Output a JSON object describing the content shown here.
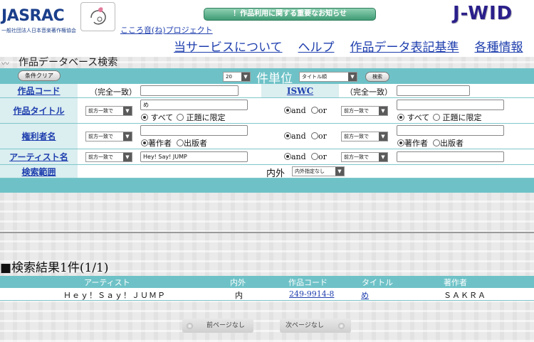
{
  "header": {
    "jasrac_logo": "JASRAC",
    "jasrac_sub": "一般社団法人日本音楽著作権協会",
    "kokoro_link": "こころ音(ね)プロジェクト",
    "notice": "！作品利用に関する重要なお知らせ",
    "jwid_logo": "J-WID",
    "nav": [
      "当サービスについて",
      "ヘルプ",
      "作品データ表記基準",
      "各種情報"
    ]
  },
  "page_title": "作品データベース検索",
  "search": {
    "clear_button": "条件クリア",
    "per_page": "20",
    "unit_label": "件単位",
    "order": "タイトル順",
    "search_button": "検索",
    "code_label": "作品コード",
    "code_hint": "（完全一致）",
    "iswc_label": "ISWC",
    "iswc_hint": "（完全一致）",
    "title_label": "作品タイトル",
    "title_match": "前方一致で",
    "title_value": "め",
    "title_opt_all": "すべて",
    "title_opt_main": "正題に限定",
    "and": "and",
    "or": "or",
    "title2_match": "前方一致で",
    "rights_label": "権利者名",
    "rights_match": "前方一致で",
    "rights_opt_author": "著作者",
    "rights_opt_publisher": "出版者",
    "rights2_match": "前方一致で",
    "artist_label": "アーティスト名",
    "artist_match": "前方一致で",
    "artist_value": "Hey! Say! JUMP",
    "artist2_match": "前方一致で",
    "scope_label": "検索範囲",
    "scope_text": "内外",
    "scope_select": "内外指定なし"
  },
  "results": {
    "title": "■検索結果1件(1/1)",
    "columns": [
      "アーティスト",
      "内外",
      "作品コード",
      "タイトル",
      "著作者"
    ],
    "rows": [
      {
        "artist": "Ｈｅｙ！Ｓａｙ！ＪＵＭＰ",
        "scope": "内",
        "code": "249-9914-8",
        "title": "め",
        "author": "ＳＡＫＲＡ"
      }
    ]
  },
  "pager": {
    "prev": "前ページなし",
    "next": "次ページなし"
  }
}
